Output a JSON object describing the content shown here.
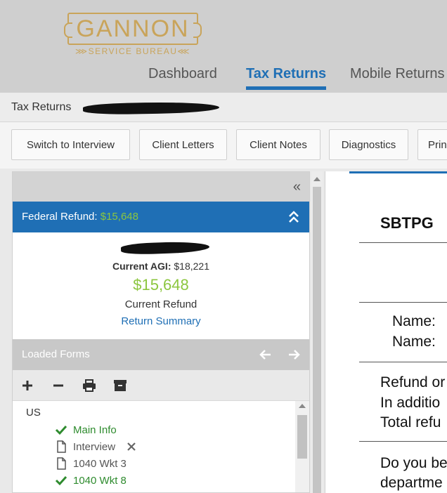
{
  "brand": {
    "name": "GANNON",
    "tagline": "SERVICE BUREAU",
    "accent": "#c9a45a"
  },
  "nav": {
    "tabs": [
      "Dashboard",
      "Tax Returns",
      "Mobile Returns"
    ],
    "active": "Tax Returns",
    "accent": "#1f6fb5"
  },
  "breadcrumb": {
    "label": "Tax Returns"
  },
  "toolbar": {
    "buttons": [
      "Switch to Interview",
      "Client Letters",
      "Client Notes",
      "Diagnostics",
      "Prin"
    ]
  },
  "refund": {
    "label": "Federal  Refund:",
    "amount": "$15,648",
    "agi_label": "Current AGI:",
    "agi_value": "$18,221",
    "big_amount": "$15,648",
    "caption": "Current Refund",
    "link": "Return Summary"
  },
  "forms": {
    "title": "Loaded Forms",
    "root": "US",
    "items": [
      {
        "label": "Main Info",
        "status": "done"
      },
      {
        "label": "Interview",
        "status": "doc"
      },
      {
        "label": "1040 Wkt 3",
        "status": "doc"
      },
      {
        "label": "1040 Wkt 8",
        "status": "done"
      }
    ]
  },
  "document": {
    "heading": "SBTPG",
    "name_label_1": "Name:",
    "name_label_2": "Name:",
    "line_1": "Refund or",
    "line_2": "In additio",
    "line_3": "Total refu",
    "line_4": "Do you be",
    "line_5": "departme"
  }
}
